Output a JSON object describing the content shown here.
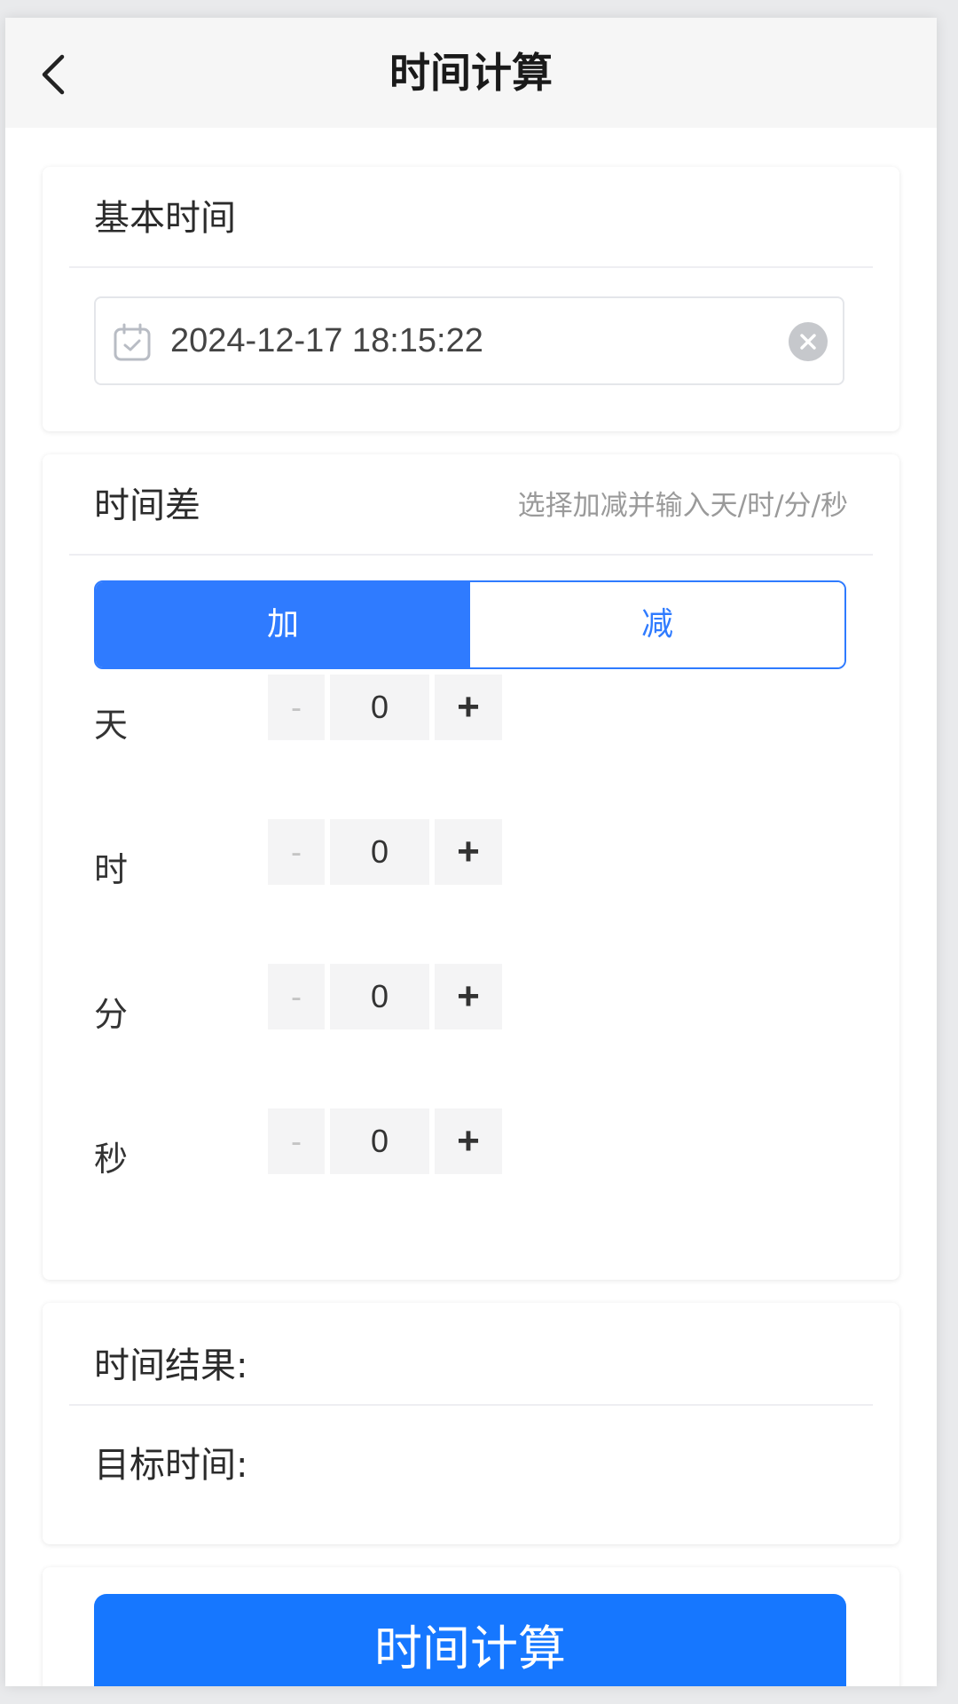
{
  "header": {
    "title": "时间计算",
    "back_icon": "chevron-left-icon"
  },
  "base_time": {
    "title": "基本时间",
    "value": "2024-12-17 18:15:22",
    "calendar_icon": "calendar-icon",
    "clear_icon": "clear-icon"
  },
  "diff": {
    "title": "时间差",
    "hint": "选择加减并输入天/时/分/秒",
    "add_label": "加",
    "sub_label": "减",
    "selected": "加",
    "rows": [
      {
        "label": "天",
        "minus": "-",
        "value": "0",
        "plus": "+"
      },
      {
        "label": "时",
        "minus": "-",
        "value": "0",
        "plus": "+"
      },
      {
        "label": "分",
        "minus": "-",
        "value": "0",
        "plus": "+"
      },
      {
        "label": "秒",
        "minus": "-",
        "value": "0",
        "plus": "+"
      }
    ]
  },
  "result": {
    "result_label": "时间结果:",
    "target_label": "目标时间:"
  },
  "action": {
    "submit_label": "时间计算"
  },
  "colors": {
    "accent": "#2f7bff",
    "button": "#1677ff",
    "stepper_bg": "#f4f4f5"
  }
}
